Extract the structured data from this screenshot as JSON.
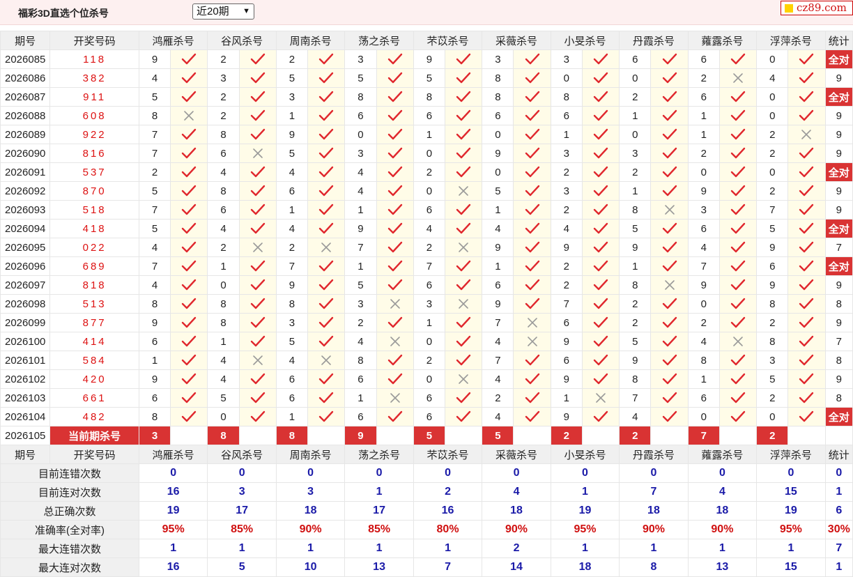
{
  "header": {
    "title": "福彩3D直选个位杀号",
    "period_select": "近20期",
    "logo": "cz89.com"
  },
  "columns": {
    "period": "期号",
    "draw": "开奖号码",
    "stat": "统计",
    "experts": [
      "鸿雁杀号",
      "谷风杀号",
      "周南杀号",
      "荡之杀号",
      "芣苡杀号",
      "采薇杀号",
      "小旻杀号",
      "丹霞杀号",
      "蕹露杀号",
      "浮萍杀号"
    ]
  },
  "rows": [
    {
      "period": "2026085",
      "draw": "118",
      "picks": [
        [
          9,
          1
        ],
        [
          2,
          1
        ],
        [
          2,
          1
        ],
        [
          3,
          1
        ],
        [
          9,
          1
        ],
        [
          3,
          1
        ],
        [
          3,
          1
        ],
        [
          6,
          1
        ],
        [
          6,
          1
        ],
        [
          0,
          1
        ]
      ],
      "stat": "全对"
    },
    {
      "period": "2026086",
      "draw": "382",
      "picks": [
        [
          4,
          1
        ],
        [
          3,
          1
        ],
        [
          5,
          1
        ],
        [
          5,
          1
        ],
        [
          5,
          1
        ],
        [
          8,
          1
        ],
        [
          0,
          1
        ],
        [
          0,
          1
        ],
        [
          2,
          0
        ],
        [
          4,
          1
        ]
      ],
      "stat": "9"
    },
    {
      "period": "2026087",
      "draw": "911",
      "picks": [
        [
          5,
          1
        ],
        [
          2,
          1
        ],
        [
          3,
          1
        ],
        [
          8,
          1
        ],
        [
          8,
          1
        ],
        [
          8,
          1
        ],
        [
          8,
          1
        ],
        [
          2,
          1
        ],
        [
          6,
          1
        ],
        [
          0,
          1
        ]
      ],
      "stat": "全对"
    },
    {
      "period": "2026088",
      "draw": "608",
      "picks": [
        [
          8,
          0
        ],
        [
          2,
          1
        ],
        [
          1,
          1
        ],
        [
          6,
          1
        ],
        [
          6,
          1
        ],
        [
          6,
          1
        ],
        [
          6,
          1
        ],
        [
          1,
          1
        ],
        [
          1,
          1
        ],
        [
          0,
          1
        ]
      ],
      "stat": "9"
    },
    {
      "period": "2026089",
      "draw": "922",
      "picks": [
        [
          7,
          1
        ],
        [
          8,
          1
        ],
        [
          9,
          1
        ],
        [
          0,
          1
        ],
        [
          1,
          1
        ],
        [
          0,
          1
        ],
        [
          1,
          1
        ],
        [
          0,
          1
        ],
        [
          1,
          1
        ],
        [
          2,
          0
        ]
      ],
      "stat": "9"
    },
    {
      "period": "2026090",
      "draw": "816",
      "picks": [
        [
          7,
          1
        ],
        [
          6,
          0
        ],
        [
          5,
          1
        ],
        [
          3,
          1
        ],
        [
          0,
          1
        ],
        [
          9,
          1
        ],
        [
          3,
          1
        ],
        [
          3,
          1
        ],
        [
          2,
          1
        ],
        [
          2,
          1
        ]
      ],
      "stat": "9"
    },
    {
      "period": "2026091",
      "draw": "537",
      "picks": [
        [
          2,
          1
        ],
        [
          4,
          1
        ],
        [
          4,
          1
        ],
        [
          4,
          1
        ],
        [
          2,
          1
        ],
        [
          0,
          1
        ],
        [
          2,
          1
        ],
        [
          2,
          1
        ],
        [
          0,
          1
        ],
        [
          0,
          1
        ]
      ],
      "stat": "全对"
    },
    {
      "period": "2026092",
      "draw": "870",
      "picks": [
        [
          5,
          1
        ],
        [
          8,
          1
        ],
        [
          6,
          1
        ],
        [
          4,
          1
        ],
        [
          0,
          0
        ],
        [
          5,
          1
        ],
        [
          3,
          1
        ],
        [
          1,
          1
        ],
        [
          9,
          1
        ],
        [
          2,
          1
        ]
      ],
      "stat": "9"
    },
    {
      "period": "2026093",
      "draw": "518",
      "picks": [
        [
          7,
          1
        ],
        [
          6,
          1
        ],
        [
          1,
          1
        ],
        [
          1,
          1
        ],
        [
          6,
          1
        ],
        [
          1,
          1
        ],
        [
          2,
          1
        ],
        [
          8,
          0
        ],
        [
          3,
          1
        ],
        [
          7,
          1
        ]
      ],
      "stat": "9"
    },
    {
      "period": "2026094",
      "draw": "418",
      "picks": [
        [
          5,
          1
        ],
        [
          4,
          1
        ],
        [
          4,
          1
        ],
        [
          9,
          1
        ],
        [
          4,
          1
        ],
        [
          4,
          1
        ],
        [
          4,
          1
        ],
        [
          5,
          1
        ],
        [
          6,
          1
        ],
        [
          5,
          1
        ]
      ],
      "stat": "全对"
    },
    {
      "period": "2026095",
      "draw": "022",
      "picks": [
        [
          4,
          1
        ],
        [
          2,
          0
        ],
        [
          2,
          0
        ],
        [
          7,
          1
        ],
        [
          2,
          0
        ],
        [
          9,
          1
        ],
        [
          9,
          1
        ],
        [
          9,
          1
        ],
        [
          4,
          1
        ],
        [
          9,
          1
        ]
      ],
      "stat": "7"
    },
    {
      "period": "2026096",
      "draw": "689",
      "picks": [
        [
          7,
          1
        ],
        [
          1,
          1
        ],
        [
          7,
          1
        ],
        [
          1,
          1
        ],
        [
          7,
          1
        ],
        [
          1,
          1
        ],
        [
          2,
          1
        ],
        [
          1,
          1
        ],
        [
          7,
          1
        ],
        [
          6,
          1
        ]
      ],
      "stat": "全对"
    },
    {
      "period": "2026097",
      "draw": "818",
      "picks": [
        [
          4,
          1
        ],
        [
          0,
          1
        ],
        [
          9,
          1
        ],
        [
          5,
          1
        ],
        [
          6,
          1
        ],
        [
          6,
          1
        ],
        [
          2,
          1
        ],
        [
          8,
          0
        ],
        [
          9,
          1
        ],
        [
          9,
          1
        ]
      ],
      "stat": "9"
    },
    {
      "period": "2026098",
      "draw": "513",
      "picks": [
        [
          8,
          1
        ],
        [
          8,
          1
        ],
        [
          8,
          1
        ],
        [
          3,
          0
        ],
        [
          3,
          0
        ],
        [
          9,
          1
        ],
        [
          7,
          1
        ],
        [
          2,
          1
        ],
        [
          0,
          1
        ],
        [
          8,
          1
        ]
      ],
      "stat": "8"
    },
    {
      "period": "2026099",
      "draw": "877",
      "picks": [
        [
          9,
          1
        ],
        [
          8,
          1
        ],
        [
          3,
          1
        ],
        [
          2,
          1
        ],
        [
          1,
          1
        ],
        [
          7,
          0
        ],
        [
          6,
          1
        ],
        [
          2,
          1
        ],
        [
          2,
          1
        ],
        [
          2,
          1
        ]
      ],
      "stat": "9"
    },
    {
      "period": "2026100",
      "draw": "414",
      "picks": [
        [
          6,
          1
        ],
        [
          1,
          1
        ],
        [
          5,
          1
        ],
        [
          4,
          0
        ],
        [
          0,
          1
        ],
        [
          4,
          0
        ],
        [
          9,
          1
        ],
        [
          5,
          1
        ],
        [
          4,
          0
        ],
        [
          8,
          1
        ]
      ],
      "stat": "7"
    },
    {
      "period": "2026101",
      "draw": "584",
      "picks": [
        [
          1,
          1
        ],
        [
          4,
          0
        ],
        [
          4,
          0
        ],
        [
          8,
          1
        ],
        [
          2,
          1
        ],
        [
          7,
          1
        ],
        [
          6,
          1
        ],
        [
          9,
          1
        ],
        [
          8,
          1
        ],
        [
          3,
          1
        ]
      ],
      "stat": "8"
    },
    {
      "period": "2026102",
      "draw": "420",
      "picks": [
        [
          9,
          1
        ],
        [
          4,
          1
        ],
        [
          6,
          1
        ],
        [
          6,
          1
        ],
        [
          0,
          0
        ],
        [
          4,
          1
        ],
        [
          9,
          1
        ],
        [
          8,
          1
        ],
        [
          1,
          1
        ],
        [
          5,
          1
        ]
      ],
      "stat": "9"
    },
    {
      "period": "2026103",
      "draw": "661",
      "picks": [
        [
          6,
          1
        ],
        [
          5,
          1
        ],
        [
          6,
          1
        ],
        [
          1,
          0
        ],
        [
          6,
          1
        ],
        [
          2,
          1
        ],
        [
          1,
          0
        ],
        [
          7,
          1
        ],
        [
          6,
          1
        ],
        [
          2,
          1
        ]
      ],
      "stat": "8"
    },
    {
      "period": "2026104",
      "draw": "482",
      "picks": [
        [
          8,
          1
        ],
        [
          0,
          1
        ],
        [
          1,
          1
        ],
        [
          6,
          1
        ],
        [
          6,
          1
        ],
        [
          4,
          1
        ],
        [
          9,
          1
        ],
        [
          4,
          1
        ],
        [
          0,
          1
        ],
        [
          0,
          1
        ]
      ],
      "stat": "全对"
    }
  ],
  "current": {
    "period": "2026105",
    "label": "当前期杀号",
    "picks": [
      "3",
      "8",
      "8",
      "9",
      "5",
      "5",
      "2",
      "2",
      "7",
      "2"
    ]
  },
  "summary": [
    {
      "label": "目前连错次数",
      "values": [
        "0",
        "0",
        "0",
        "0",
        "0",
        "0",
        "0",
        "0",
        "0",
        "0"
      ],
      "stat": "0",
      "cls": "sv"
    },
    {
      "label": "目前连对次数",
      "values": [
        "16",
        "3",
        "3",
        "1",
        "2",
        "4",
        "1",
        "7",
        "4",
        "15"
      ],
      "stat": "1",
      "cls": "sv"
    },
    {
      "label": "总正确次数",
      "values": [
        "19",
        "17",
        "18",
        "17",
        "16",
        "18",
        "19",
        "18",
        "18",
        "19"
      ],
      "stat": "6",
      "cls": "sv"
    },
    {
      "label": "准确率(全对率)",
      "values": [
        "95%",
        "85%",
        "90%",
        "85%",
        "80%",
        "90%",
        "95%",
        "90%",
        "90%",
        "95%"
      ],
      "stat": "30%",
      "cls": "acc"
    },
    {
      "label": "最大连错次数",
      "values": [
        "1",
        "1",
        "1",
        "1",
        "1",
        "2",
        "1",
        "1",
        "1",
        "1"
      ],
      "stat": "7",
      "cls": "sv"
    },
    {
      "label": "最大连对次数",
      "values": [
        "16",
        "5",
        "10",
        "13",
        "7",
        "14",
        "18",
        "8",
        "13",
        "15"
      ],
      "stat": "1",
      "cls": "sv"
    }
  ],
  "icons": {
    "correct": "check-icon",
    "wrong": "cross-icon"
  },
  "colors": {
    "red": "#d93333",
    "check": "#e0272d",
    "cross": "#9a9a9a",
    "blue": "#1a1aa8",
    "header_bg": "#fdf0f0"
  }
}
